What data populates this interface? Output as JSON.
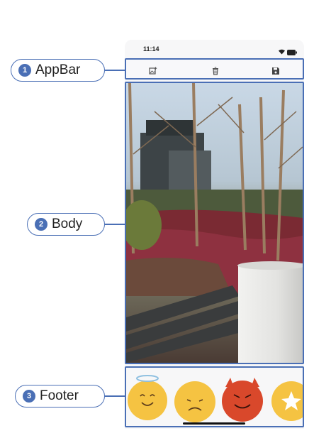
{
  "status_bar": {
    "time": "11:14"
  },
  "appbar": {
    "icons": [
      "add-photo-icon",
      "trash-icon",
      "save-icon"
    ]
  },
  "callouts": {
    "appbar": {
      "number": "1",
      "label": "AppBar"
    },
    "body": {
      "number": "2",
      "label": "Body"
    },
    "footer": {
      "number": "3",
      "label": "Footer"
    }
  },
  "footer": {
    "stickers": [
      "angel-face-sticker",
      "sad-face-sticker",
      "devil-face-sticker",
      "star-sticker"
    ]
  },
  "colors": {
    "accent": "#4a6fb5",
    "sticker_yellow": "#f5c342",
    "sticker_red": "#d9482b"
  }
}
